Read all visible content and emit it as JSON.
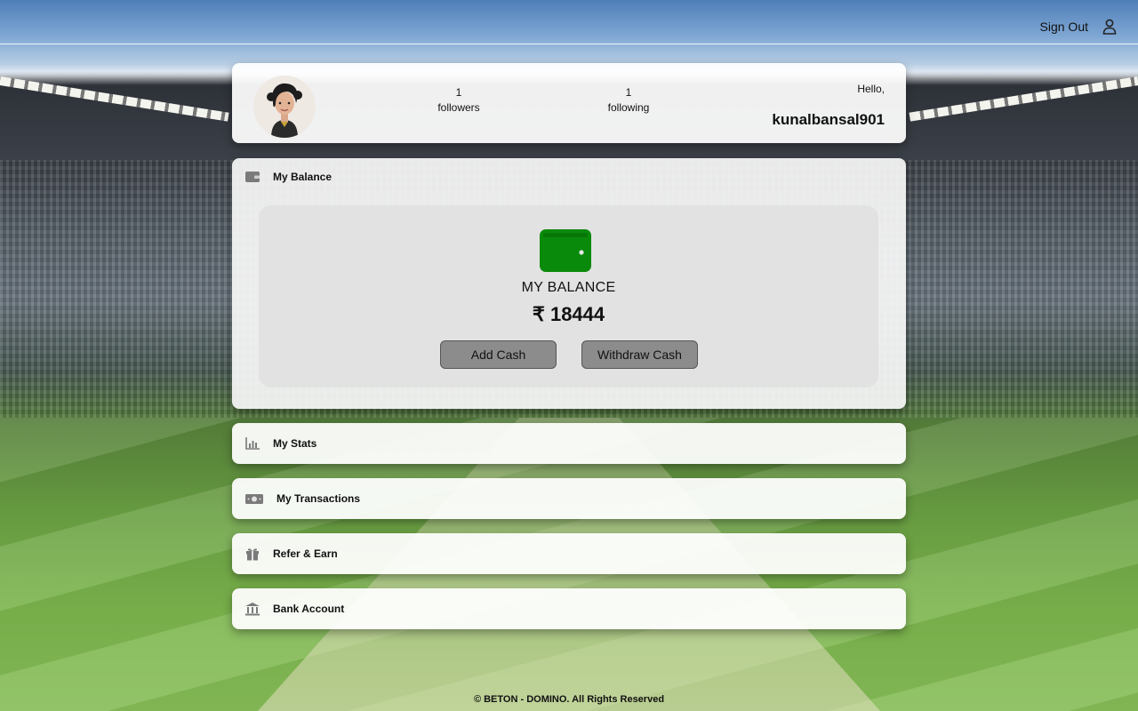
{
  "header": {
    "sign_out_label": "Sign Out",
    "user_icon": "user-icon"
  },
  "profile": {
    "followers_count": "1",
    "followers_label": "followers",
    "following_count": "1",
    "following_label": "following",
    "greeting": "Hello,",
    "username": "kunalbansal901"
  },
  "balance": {
    "section_label": "My Balance",
    "section_icon": "wallet-icon",
    "title": "MY BALANCE",
    "amount": "₹ 18444",
    "add_cash_label": "Add Cash",
    "withdraw_cash_label": "Withdraw Cash",
    "wallet_color": "#0a8a0a"
  },
  "sections": [
    {
      "label": "My Stats",
      "icon": "bar-chart-icon"
    },
    {
      "label": "My Transactions",
      "icon": "money-icon"
    },
    {
      "label": "Refer & Earn",
      "icon": "gift-icon"
    },
    {
      "label": "Bank Account",
      "icon": "bank-icon"
    }
  ],
  "footer": {
    "text": "© BETON - DOMINO. All Rights Reserved"
  }
}
